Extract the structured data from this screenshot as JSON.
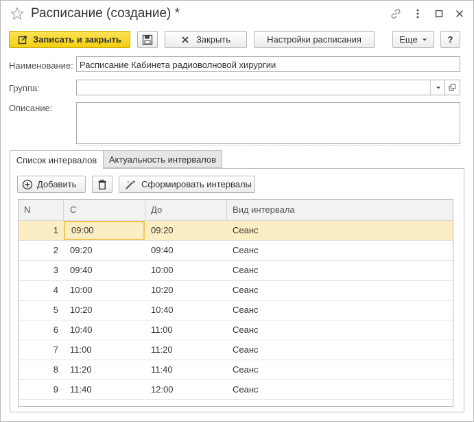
{
  "window": {
    "title": "Расписание (создание) *"
  },
  "toolbar": {
    "save_close_label": "Записать и закрыть",
    "close_label": "Закрыть",
    "schedule_settings_label": "Настройки расписания",
    "more_label": "Еще",
    "help_label": "?"
  },
  "form": {
    "name_label": "Наименование:",
    "name_value": "Расписание Кабинета радиоволновой хирургии",
    "group_label": "Группа:",
    "group_value": "",
    "description_label": "Описание:",
    "description_value": ""
  },
  "tabs": [
    {
      "label": "Список интервалов",
      "active": true
    },
    {
      "label": "Актуальность интервалов",
      "active": false
    }
  ],
  "interval_toolbar": {
    "add_label": "Добавить",
    "generate_label": "Сформировать интервалы"
  },
  "table": {
    "columns": [
      "N",
      "С",
      "До",
      "Вид интервала"
    ],
    "rows": [
      {
        "n": "1",
        "from": "09:00",
        "to": "09:20",
        "kind": "Сеанс"
      },
      {
        "n": "2",
        "from": "09:20",
        "to": "09:40",
        "kind": "Сеанс"
      },
      {
        "n": "3",
        "from": "09:40",
        "to": "10:00",
        "kind": "Сеанс"
      },
      {
        "n": "4",
        "from": "10:00",
        "to": "10:20",
        "kind": "Сеанс"
      },
      {
        "n": "5",
        "from": "10:20",
        "to": "10:40",
        "kind": "Сеанс"
      },
      {
        "n": "6",
        "from": "10:40",
        "to": "11:00",
        "kind": "Сеанс"
      },
      {
        "n": "7",
        "from": "11:00",
        "to": "11:20",
        "kind": "Сеанс"
      },
      {
        "n": "8",
        "from": "11:20",
        "to": "11:40",
        "kind": "Сеанс"
      },
      {
        "n": "9",
        "from": "11:40",
        "to": "12:00",
        "kind": "Сеанс"
      }
    ]
  },
  "colors": {
    "primary_button": "#f2cf11",
    "selected_row": "#fbeec4",
    "active_cell_border": "#f0c85a"
  }
}
